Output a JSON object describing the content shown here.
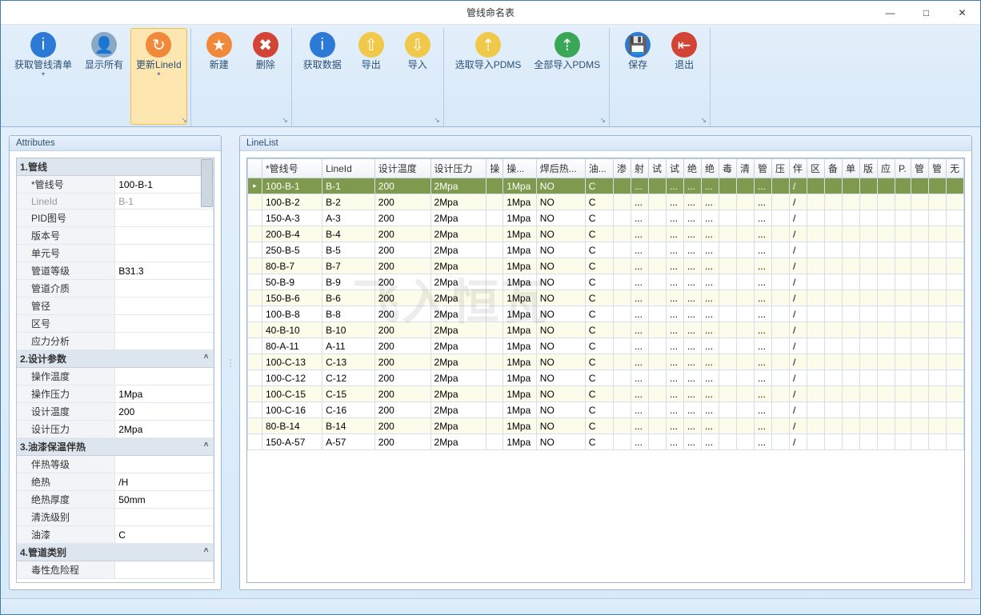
{
  "title": "管线命名表",
  "winControls": {
    "min": "—",
    "max": "□",
    "close": "✕"
  },
  "ribbon": {
    "groups": [
      {
        "buttons": [
          {
            "id": "get-list",
            "label": "获取管线清单",
            "caret": true,
            "iconBg": "#2c7ad6",
            "glyph": "i"
          },
          {
            "id": "show-all",
            "label": "显示所有",
            "caret": false,
            "iconBg": "#8aa7c4",
            "glyph": "👤"
          },
          {
            "id": "refresh-lineid",
            "label": "更新LineId",
            "caret": true,
            "iconBg": "#f0893a",
            "glyph": "↻",
            "highlighted": true
          }
        ]
      },
      {
        "buttons": [
          {
            "id": "new",
            "label": "新建",
            "iconBg": "#f0893a",
            "glyph": "★"
          },
          {
            "id": "delete",
            "label": "删除",
            "iconBg": "#d24436",
            "glyph": "✖"
          }
        ]
      },
      {
        "buttons": [
          {
            "id": "fetch-data",
            "label": "获取数据",
            "iconBg": "#2c7ad6",
            "glyph": "i"
          },
          {
            "id": "export",
            "label": "导出",
            "iconBg": "#f0c84a",
            "glyph": "⇧"
          },
          {
            "id": "import",
            "label": "导入",
            "iconBg": "#f0c84a",
            "glyph": "⇩"
          }
        ]
      },
      {
        "buttons": [
          {
            "id": "select-import-pdms",
            "label": "选取导入PDMS",
            "iconBg": "#f0c84a",
            "glyph": "⇡"
          },
          {
            "id": "all-import-pdms",
            "label": "全部导入PDMS",
            "iconBg": "#3aa757",
            "glyph": "⇡"
          }
        ]
      },
      {
        "buttons": [
          {
            "id": "save",
            "label": "保存",
            "iconBg": "#2c7ad6",
            "glyph": "💾"
          },
          {
            "id": "exit",
            "label": "退出",
            "iconBg": "#d24436",
            "glyph": "⇤"
          }
        ]
      }
    ]
  },
  "panels": {
    "left": "Attributes",
    "right": "LineList"
  },
  "propGroups": [
    {
      "name": "1.管线",
      "rows": [
        {
          "k": "*管线号",
          "v": "100-B-1"
        },
        {
          "k": "LineId",
          "v": "B-1",
          "gray": true
        },
        {
          "k": "PID图号",
          "v": ""
        },
        {
          "k": "版本号",
          "v": ""
        },
        {
          "k": "单元号",
          "v": ""
        },
        {
          "k": "管道等级",
          "v": "B31.3"
        },
        {
          "k": "管道介质",
          "v": ""
        },
        {
          "k": "管径",
          "v": ""
        },
        {
          "k": "区号",
          "v": ""
        },
        {
          "k": "应力分析",
          "v": ""
        }
      ]
    },
    {
      "name": "2.设计参数",
      "rows": [
        {
          "k": "操作温度",
          "v": ""
        },
        {
          "k": "操作压力",
          "v": "1Mpa"
        },
        {
          "k": "设计温度",
          "v": "200"
        },
        {
          "k": "设计压力",
          "v": "2Mpa"
        }
      ]
    },
    {
      "name": "3.油漆保温伴热",
      "rows": [
        {
          "k": "伴热等级",
          "v": ""
        },
        {
          "k": "绝热",
          "v": "/H"
        },
        {
          "k": "绝热厚度",
          "v": "50mm"
        },
        {
          "k": "清洗级别",
          "v": ""
        },
        {
          "k": "油漆",
          "v": "C"
        }
      ]
    },
    {
      "name": "4.管道类别",
      "rows": [
        {
          "k": "毒性危险程",
          "v": ""
        }
      ]
    }
  ],
  "gridColumns": [
    "*管线号",
    "LineId",
    "设计温度",
    "设计压力",
    "操",
    "操...",
    "焊后热...",
    "油...",
    "渗",
    "射",
    "试",
    "试",
    "绝",
    "绝",
    "毒",
    "清",
    "管",
    "压",
    "伴",
    "区",
    "备",
    "单",
    "版",
    "应",
    "P.",
    "管",
    "管",
    "无"
  ],
  "gridData": [
    {
      "pipe": "100-B-1",
      "lineid": "B-1",
      "selected": true
    },
    {
      "pipe": "100-B-2",
      "lineid": "B-2"
    },
    {
      "pipe": "150-A-3",
      "lineid": "A-3"
    },
    {
      "pipe": "200-B-4",
      "lineid": "B-4"
    },
    {
      "pipe": "250-B-5",
      "lineid": "B-5"
    },
    {
      "pipe": "80-B-7",
      "lineid": "B-7"
    },
    {
      "pipe": "50-B-9",
      "lineid": "B-9"
    },
    {
      "pipe": "150-B-6",
      "lineid": "B-6"
    },
    {
      "pipe": "100-B-8",
      "lineid": "B-8"
    },
    {
      "pipe": "40-B-10",
      "lineid": "B-10"
    },
    {
      "pipe": "80-A-11",
      "lineid": "A-11"
    },
    {
      "pipe": "100-C-13",
      "lineid": "C-13"
    },
    {
      "pipe": "100-C-12",
      "lineid": "C-12"
    },
    {
      "pipe": "100-C-15",
      "lineid": "C-15"
    },
    {
      "pipe": "100-C-16",
      "lineid": "C-16"
    },
    {
      "pipe": "80-B-14",
      "lineid": "B-14"
    },
    {
      "pipe": "150-A-57",
      "lineid": "A-57"
    }
  ],
  "gridDefaults": {
    "temp": "200",
    "press": "2Mpa",
    "op": "1Mpa",
    "heat": "NO",
    "paint": "C",
    "ellipsis": "...",
    "slash": "/"
  }
}
